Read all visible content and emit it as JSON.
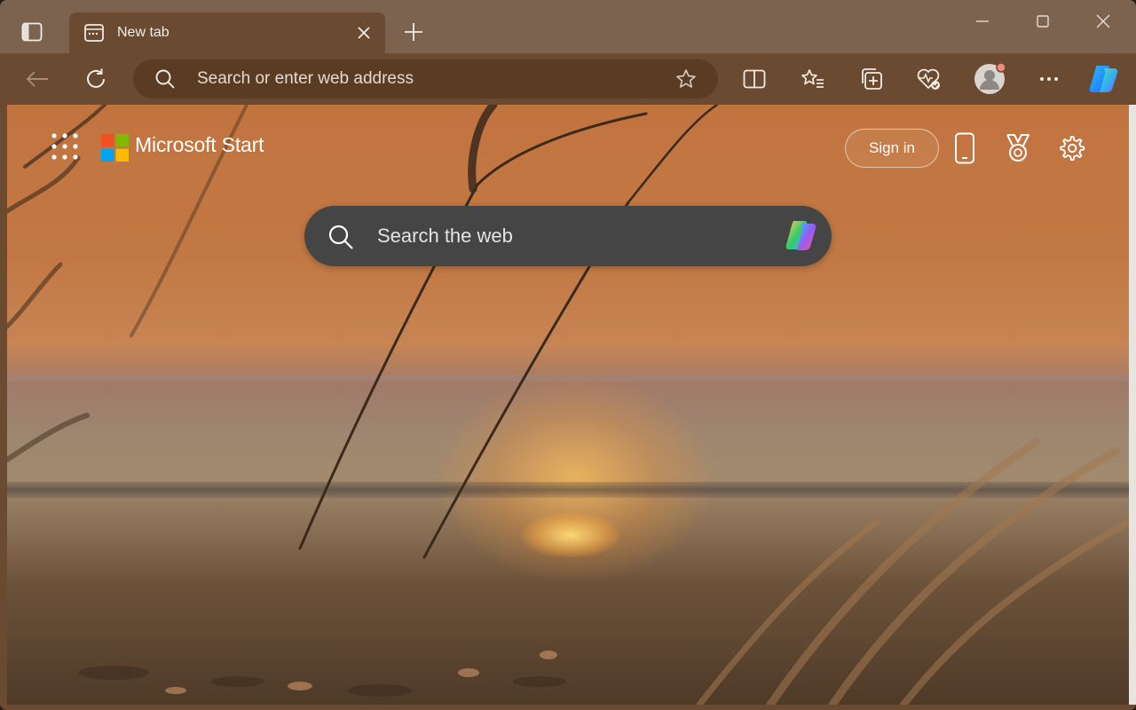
{
  "tabstrip": {
    "tab_title": "New tab"
  },
  "toolbar": {
    "address_placeholder": "Search or enter web address"
  },
  "page": {
    "brand": "Microsoft Start",
    "sign_in_label": "Sign in",
    "search_placeholder": "Search the web"
  },
  "icons": {
    "tab_actions": "tab-actions-icon",
    "new_tab_page": "new-tab-page-icon",
    "close": "close-icon",
    "plus": "plus-icon",
    "back": "back-arrow-icon",
    "refresh": "refresh-icon",
    "search": "search-icon",
    "favorite": "star-icon",
    "split_screen": "split-screen-icon",
    "favorites": "favorites-icon",
    "collections": "collections-icon",
    "browser_essentials": "heart-pulse-icon",
    "profile": "profile-icon",
    "more": "more-icon",
    "copilot": "copilot-icon",
    "apps": "app-launcher-icon",
    "phone": "phone-icon",
    "rewards": "rewards-trophy-icon",
    "settings": "gear-icon"
  },
  "colors": {
    "tabstrip": "#7b6350",
    "toolbar": "#6a4a31",
    "address_bar": "#5a3c25",
    "web_search_box": "#454545"
  }
}
